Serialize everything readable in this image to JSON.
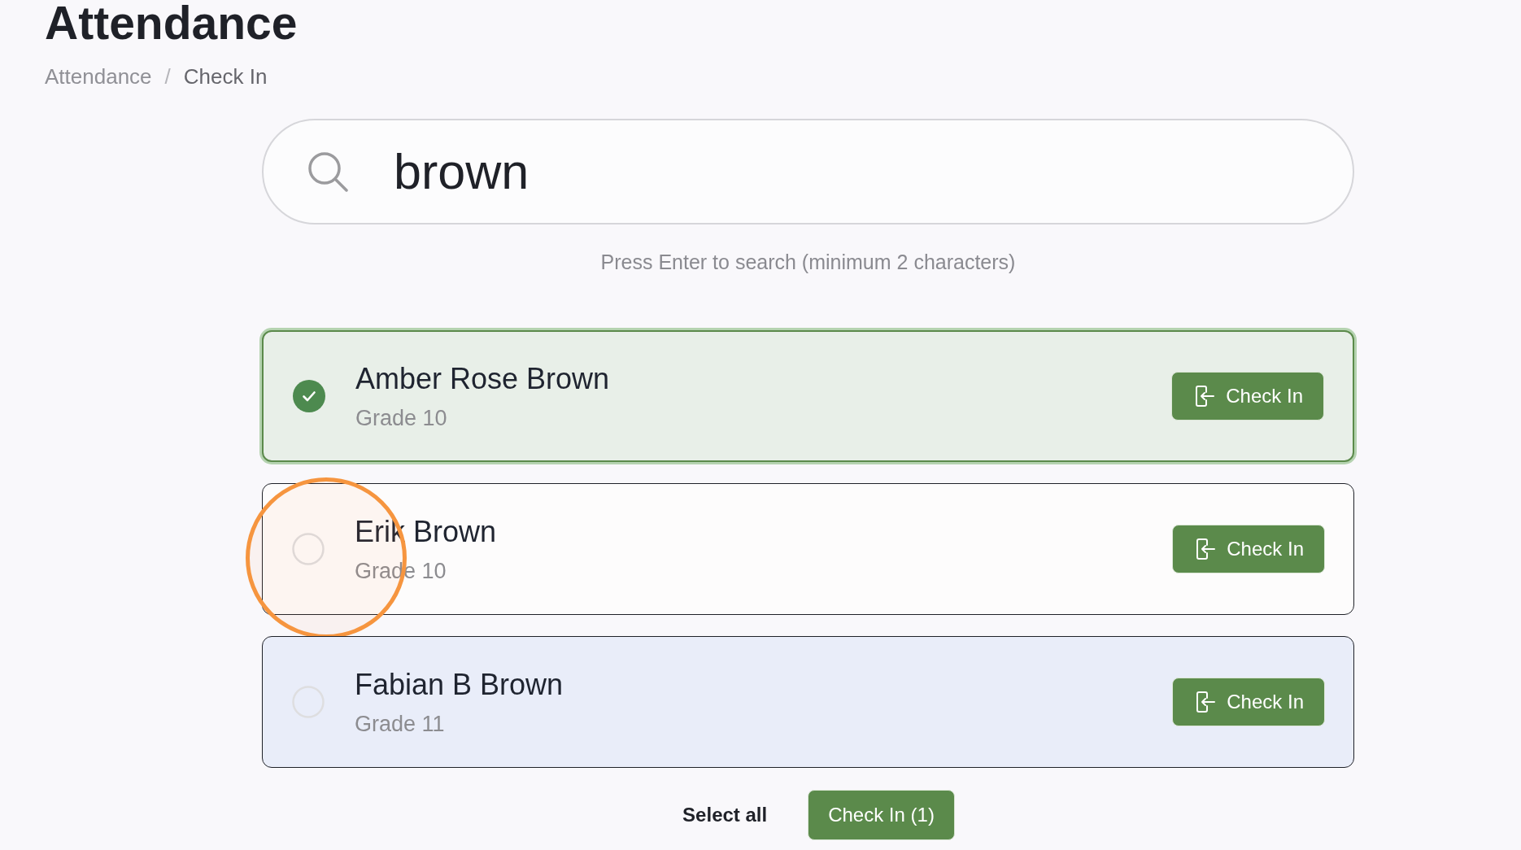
{
  "page": {
    "title": "Attendance"
  },
  "breadcrumb": {
    "items": [
      {
        "label": "Attendance",
        "current": false
      },
      {
        "label": "Check In",
        "current": true
      }
    ],
    "separator": "/"
  },
  "search": {
    "value": "brown",
    "hint": "Press Enter to search (minimum 2 characters)"
  },
  "students": [
    {
      "name": "Amber Rose Brown",
      "grade": "Grade 10",
      "selected": true,
      "hovered": false,
      "click_marker": false,
      "action": "Check In"
    },
    {
      "name": "Erik Brown",
      "grade": "Grade 10",
      "selected": false,
      "hovered": false,
      "click_marker": true,
      "action": "Check In"
    },
    {
      "name": "Fabian B Brown",
      "grade": "Grade 11",
      "selected": false,
      "hovered": true,
      "click_marker": false,
      "action": "Check In"
    }
  ],
  "footer": {
    "select_all": "Select all",
    "check_in_button": "Check In (1)"
  }
}
